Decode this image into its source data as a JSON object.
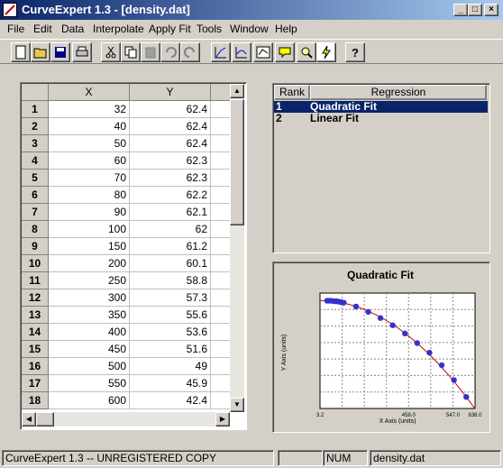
{
  "window": {
    "title": "CurveExpert 1.3 - [density.dat]"
  },
  "menu": [
    "File",
    "Edit",
    "Data",
    "Interpolate",
    "Apply Fit",
    "Tools",
    "Window",
    "Help"
  ],
  "toolbar": {
    "icons": [
      "new-file-icon",
      "open-folder-icon",
      "save-icon",
      "print-icon",
      "cut-icon",
      "copy-icon",
      "paste-icon",
      "undo-icon",
      "redo-icon",
      "plot-icon",
      "residual-plot-icon",
      "poly-icon",
      "info-icon",
      "zoom-icon",
      "lightning-icon",
      "help-icon"
    ]
  },
  "grid": {
    "columns": [
      "X",
      "Y"
    ],
    "rows": [
      {
        "n": "1",
        "x": "32",
        "y": "62.4"
      },
      {
        "n": "2",
        "x": "40",
        "y": "62.4"
      },
      {
        "n": "3",
        "x": "50",
        "y": "62.4"
      },
      {
        "n": "4",
        "x": "60",
        "y": "62.3"
      },
      {
        "n": "5",
        "x": "70",
        "y": "62.3"
      },
      {
        "n": "6",
        "x": "80",
        "y": "62.2"
      },
      {
        "n": "7",
        "x": "90",
        "y": "62.1"
      },
      {
        "n": "8",
        "x": "100",
        "y": "62"
      },
      {
        "n": "9",
        "x": "150",
        "y": "61.2"
      },
      {
        "n": "10",
        "x": "200",
        "y": "60.1"
      },
      {
        "n": "11",
        "x": "250",
        "y": "58.8"
      },
      {
        "n": "12",
        "x": "300",
        "y": "57.3"
      },
      {
        "n": "13",
        "x": "350",
        "y": "55.6"
      },
      {
        "n": "14",
        "x": "400",
        "y": "53.6"
      },
      {
        "n": "15",
        "x": "450",
        "y": "51.6"
      },
      {
        "n": "16",
        "x": "500",
        "y": "49"
      },
      {
        "n": "17",
        "x": "550",
        "y": "45.9"
      },
      {
        "n": "18",
        "x": "600",
        "y": "42.4"
      }
    ]
  },
  "rank_panel": {
    "headers": {
      "rank": "Rank",
      "regression": "Regression"
    },
    "items": [
      {
        "rank": "1",
        "name": "Quadratic Fit",
        "selected": true
      },
      {
        "rank": "2",
        "name": "Linear Fit",
        "selected": false
      }
    ]
  },
  "chart_data": {
    "type": "scatter",
    "title": "Quadratic Fit",
    "xlabel": "X Axis (units)",
    "ylabel": "Y Axis (units)",
    "x_ticks": [
      "3.2",
      "???",
      "???",
      "???",
      "???",
      "???",
      "???",
      "???"
    ],
    "x_ticks_note_readable": [
      "3.2",
      "",
      "",
      "",
      "458.0",
      "",
      "547.0",
      "636.0"
    ],
    "grid": true,
    "series": [
      {
        "points": [
          [
            32,
            62.4
          ],
          [
            40,
            62.4
          ],
          [
            50,
            62.4
          ],
          [
            60,
            62.3
          ],
          [
            70,
            62.3
          ],
          [
            80,
            62.2
          ],
          [
            90,
            62.1
          ],
          [
            100,
            62
          ],
          [
            150,
            61.2
          ],
          [
            200,
            60.1
          ],
          [
            250,
            58.8
          ],
          [
            300,
            57.3
          ],
          [
            350,
            55.6
          ],
          [
            400,
            53.6
          ],
          [
            450,
            51.6
          ],
          [
            500,
            49
          ],
          [
            550,
            45.9
          ],
          [
            600,
            42.4
          ]
        ],
        "color": "#3333cc"
      }
    ],
    "fit_color": "#cc0000"
  },
  "status": {
    "left": "CurveExpert 1.3 -- UNREGISTERED COPY",
    "num": "NUM",
    "file": "density.dat"
  }
}
